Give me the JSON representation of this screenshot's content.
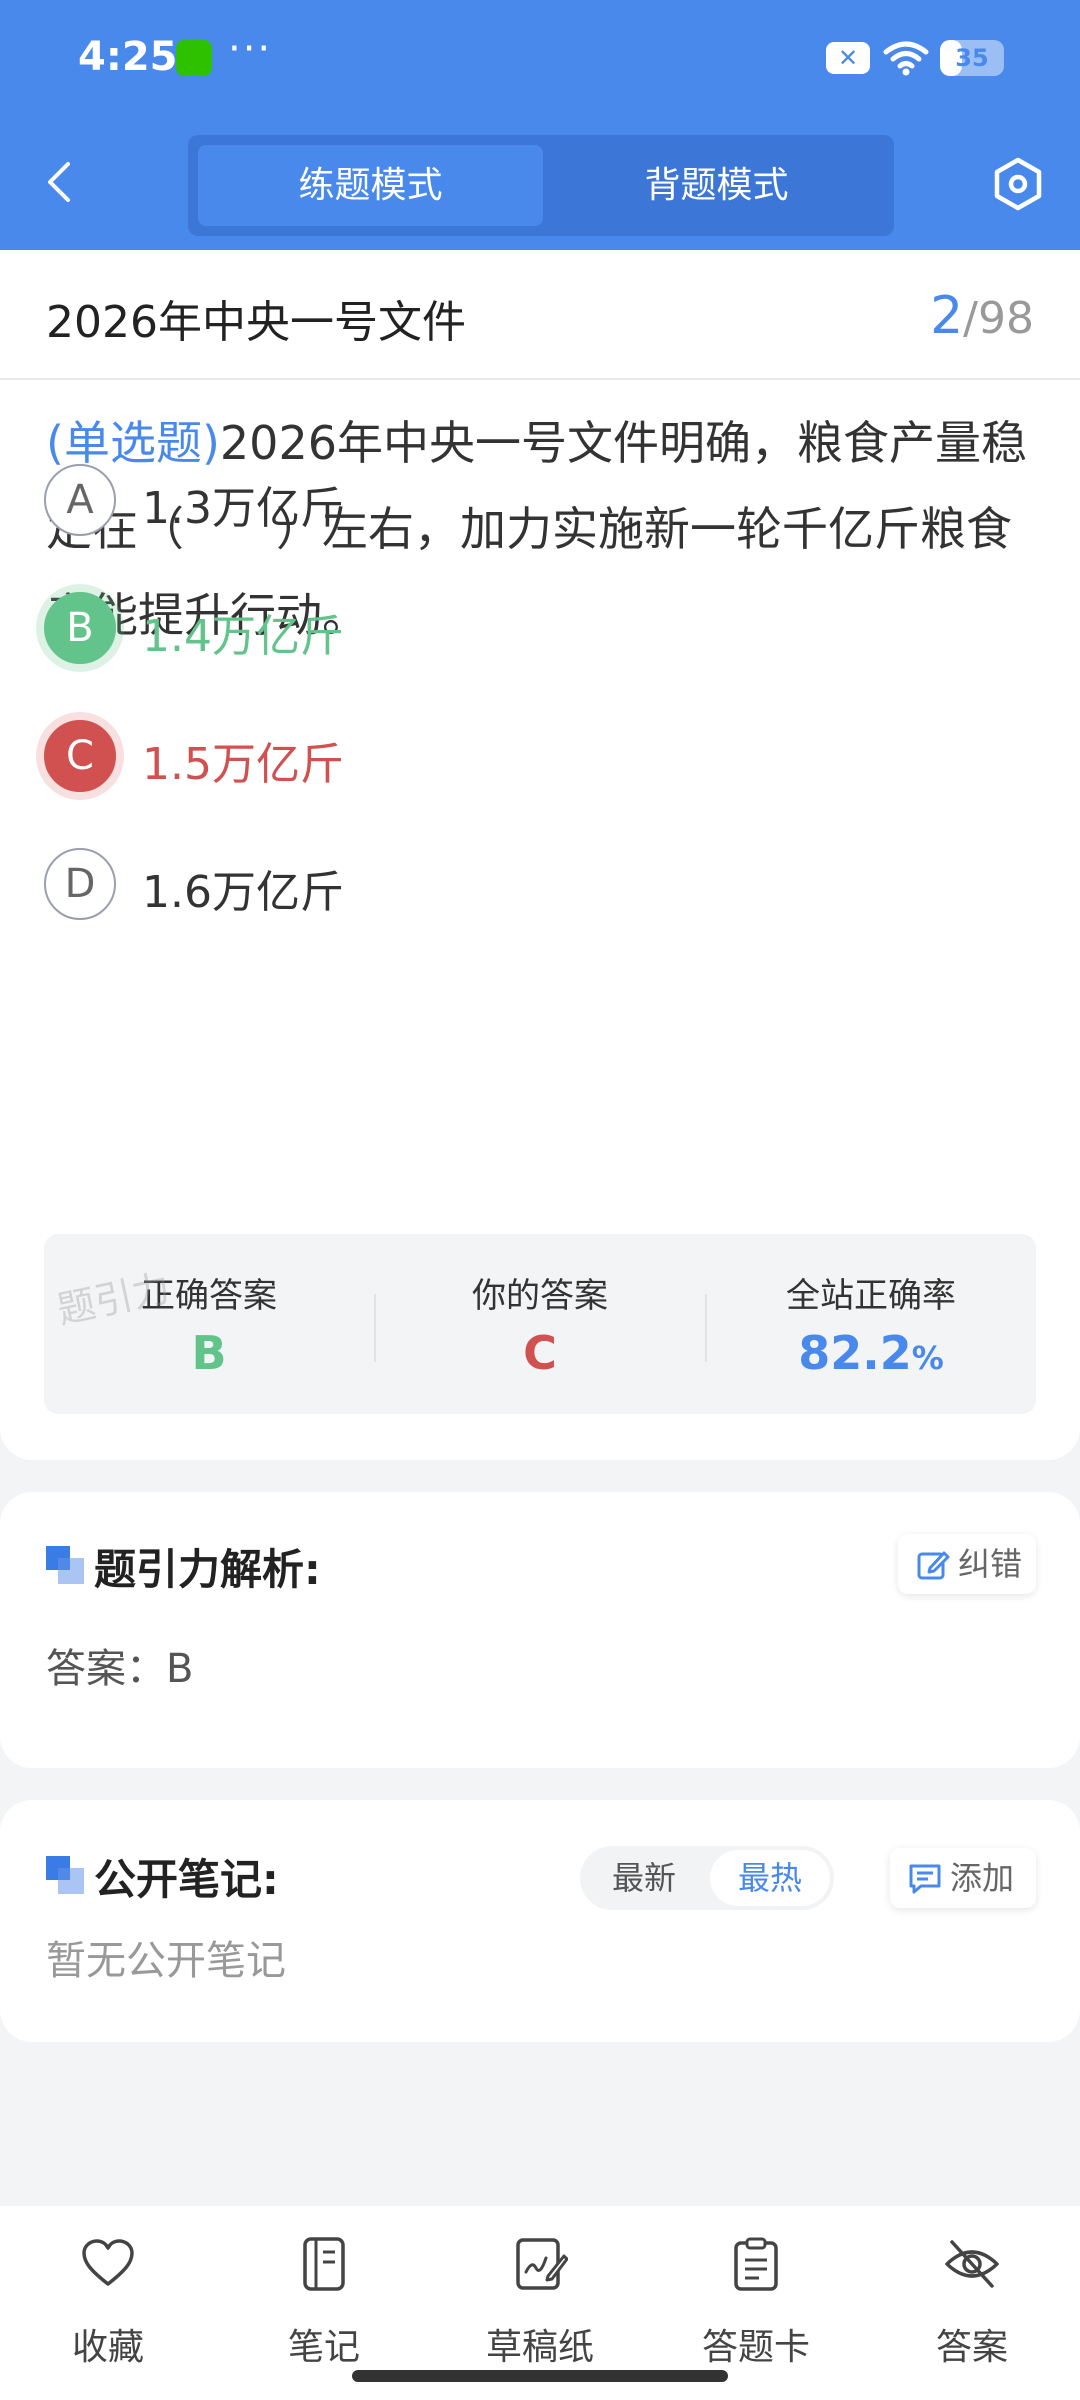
{
  "status_bar": {
    "time": "4:25",
    "more": "···",
    "battery": 35,
    "battery_label": "35"
  },
  "header": {
    "modes": [
      "练题模式",
      "背题模式"
    ],
    "active_mode": "练题模式"
  },
  "paper": {
    "title": "2026年中央一号文件",
    "current": "2",
    "separator": "/",
    "total": "98"
  },
  "question": {
    "type": "(单选题)",
    "text": "2026年中央一号文件明确，粮食产量稳定在（　　）左右，加力实施新一轮千亿斤粮食产能提升行动。",
    "options": [
      {
        "letter": "A",
        "text": "1.3万亿斤",
        "state": "normal"
      },
      {
        "letter": "B",
        "text": "1.4万亿斤",
        "state": "correct"
      },
      {
        "letter": "C",
        "text": "1.5万亿斤",
        "state": "wrong"
      },
      {
        "letter": "D",
        "text": "1.6万亿斤",
        "state": "normal"
      }
    ]
  },
  "result": {
    "correct_label": "正确答案",
    "correct_value": "B",
    "yours_label": "你的答案",
    "yours_value": "C",
    "rate_label": "全站正确率",
    "rate_value": "82.2",
    "rate_unit": "%",
    "watermark": "题引力"
  },
  "analysis": {
    "title": "题引力解析:",
    "report_button": "纠错",
    "answer_text": "答案：B"
  },
  "notes": {
    "title": "公开笔记:",
    "sort_options": [
      "最新",
      "最热"
    ],
    "active_sort": "最热",
    "add_button": "添加",
    "empty_text": "暂无公开笔记"
  },
  "bottom_nav": [
    "收藏",
    "笔记",
    "草稿纸",
    "答题卡",
    "答案"
  ],
  "colors": {
    "primary": "#4a89ec",
    "correct": "#62c48a",
    "wrong": "#d0514f",
    "background": "#f3f4f6"
  }
}
